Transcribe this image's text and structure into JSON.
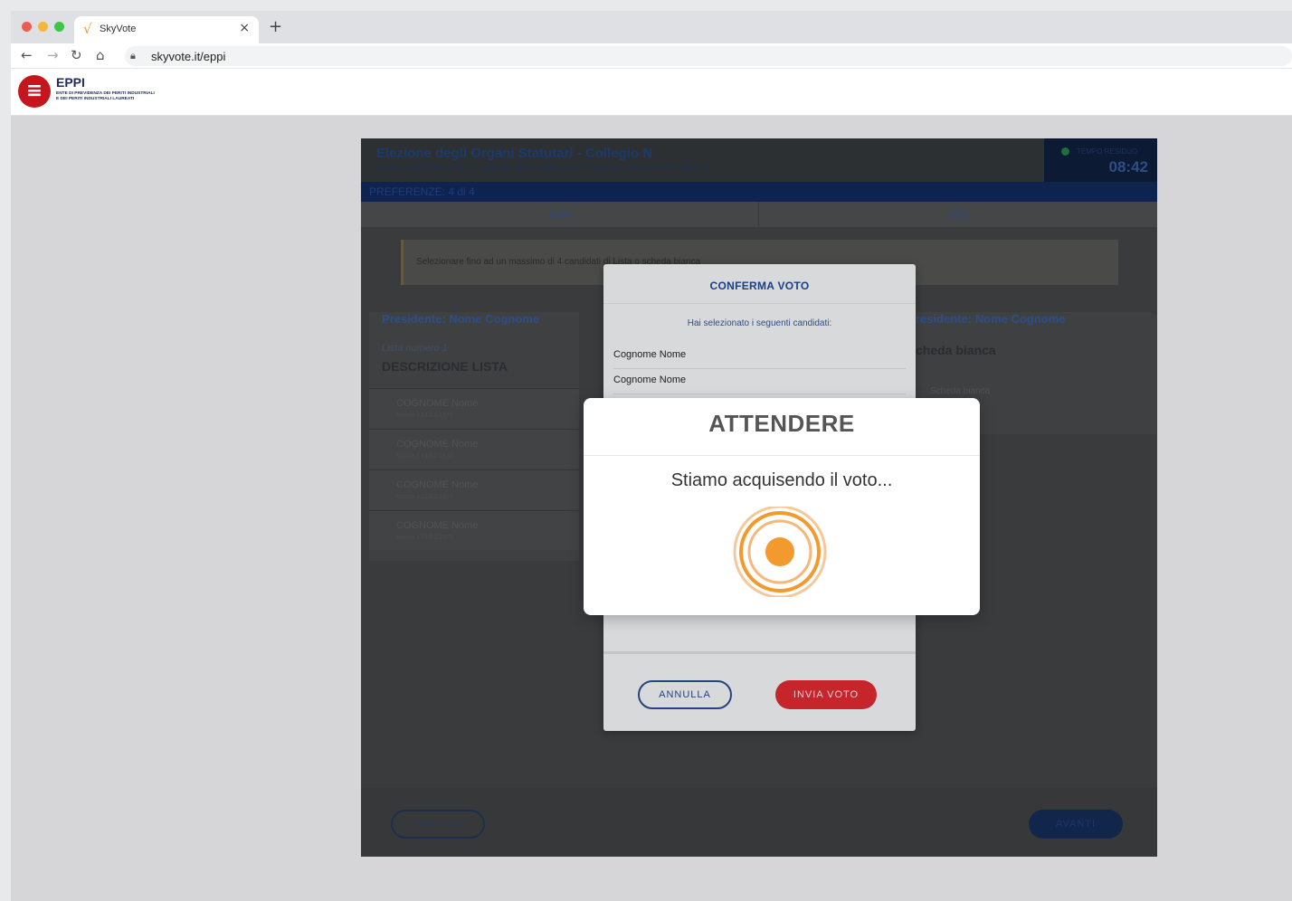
{
  "browser": {
    "tab_title": "SkyVote",
    "tab_icon": "√",
    "url": "skyvote.it/eppi"
  },
  "site": {
    "logo_name": "EPPI",
    "logo_sub_line1": "ENTE DI PREVIDENZA DEI PERITI INDUSTRIALI",
    "logo_sub_line2": "E DEI PERITI INDUSTRIALI LAUREATI"
  },
  "election": {
    "title": "Elezione degli Organi Statutari - Collegio N",
    "subtitle": "Elezione dei componenti del Consiglio di Amministrazione e del Consiglio di Indirizzo Generale dell'Eppi",
    "timer_label": "TEMPO RESIDUO",
    "timer_value": "08:42",
    "preferences": "PREFERENZE: 4 di 4",
    "tabs": [
      "CdA",
      "CIG"
    ],
    "notice": "Selezionare fino ad un massimo di 4 candidati di Lista o scheda bianca",
    "list": {
      "president": "Presidente: Nome Cognome",
      "number": "Lista numero 1",
      "description": "DESCRIZIONE LISTA",
      "candidates": [
        {
          "name": "COGNOME Nome",
          "sub": "Nato/a il 01/01/1970"
        },
        {
          "name": "COGNOME Nome",
          "sub": "Nato/a il 01/01/1970"
        },
        {
          "name": "COGNOME Nome",
          "sub": "Nato/a il 01/01/1970"
        },
        {
          "name": "COGNOME Nome",
          "sub": "Nato/a il 01/01/1970"
        }
      ]
    },
    "right": {
      "president": "residente: Nome Cognome",
      "bianca": "cheda bianca",
      "sub": "Scheda bianca"
    },
    "footer": {
      "annulla": "ANNULLA",
      "avanti": "AVANTI"
    }
  },
  "confirm_modal": {
    "title": "CONFERMA VOTO",
    "intro": "Hai selezionato i seguenti candidati:",
    "candidates": [
      "Cognome Nome",
      "Cognome Nome"
    ],
    "annulla": "ANNULLA",
    "invia": "INVIA VOTO"
  },
  "wait_modal": {
    "title": "ATTENDERE",
    "message": "Stiamo acquisendo il voto..."
  },
  "colors": {
    "accent_orange": "#f29a2e",
    "brand_red": "#c4161c",
    "brand_blue": "#1b3f85"
  }
}
